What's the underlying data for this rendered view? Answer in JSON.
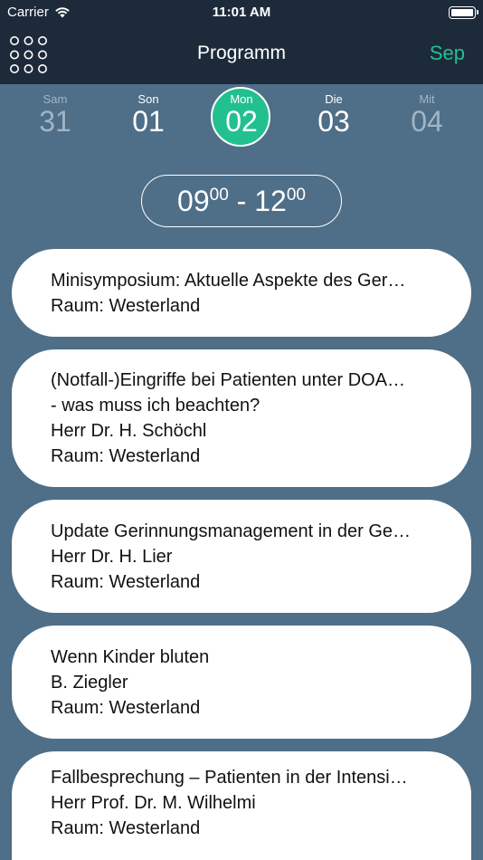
{
  "status_bar": {
    "carrier": "Carrier",
    "time": "11:01 AM"
  },
  "nav": {
    "title": "Programm",
    "month": "Sep",
    "accent_color": "#22c08f"
  },
  "days": [
    {
      "name": "Sam",
      "number": "31",
      "state": "dim"
    },
    {
      "name": "Son",
      "number": "01",
      "state": "normal"
    },
    {
      "name": "Mon",
      "number": "02",
      "state": "selected"
    },
    {
      "name": "Die",
      "number": "03",
      "state": "normal"
    },
    {
      "name": "Mit",
      "number": "04",
      "state": "dim"
    }
  ],
  "time_slot": {
    "start_hour": "09",
    "start_min": "00",
    "separator": " - ",
    "end_hour": "12",
    "end_min": "00"
  },
  "sessions": [
    {
      "title": "Minisymposium: Aktuelle Aspekte des Ger…",
      "room": "Raum: Westerland"
    },
    {
      "title": "(Notfall-)Eingriffe bei Patienten unter DOA…",
      "title_2": "- was muss ich beachten?",
      "speaker": "Herr Dr. H. Schöchl",
      "room": "Raum: Westerland"
    },
    {
      "title": "Update Gerinnungsmanagement in der Ge…",
      "speaker": "Herr Dr. H. Lier",
      "room": "Raum: Westerland"
    },
    {
      "title": "Wenn Kinder bluten",
      "speaker": "B. Ziegler",
      "room": "Raum: Westerland"
    },
    {
      "title": "Fallbesprechung – Patienten in der Intensi…",
      "speaker": "Herr Prof. Dr. M. Wilhelmi",
      "room": "Raum: Westerland"
    }
  ]
}
